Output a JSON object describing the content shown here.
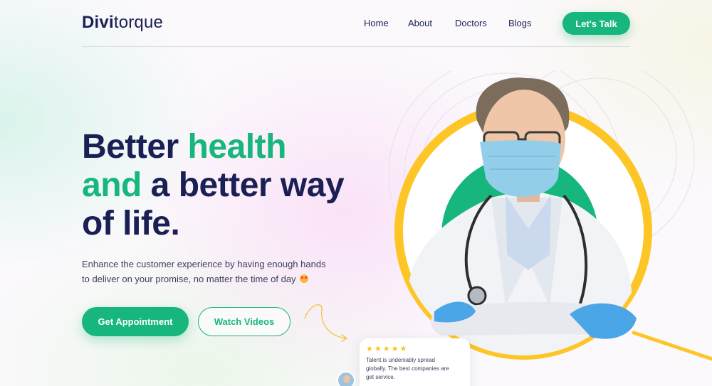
{
  "header": {
    "logo_bold": "Divi",
    "logo_rest": "torque",
    "nav": [
      "Home",
      "About",
      "Doctors",
      "Blogs"
    ],
    "cta_label": "Let's Talk"
  },
  "hero": {
    "title_1": "Better ",
    "title_2": "health",
    "title_3": "and",
    "title_4": " a better way",
    "title_5": "of life.",
    "description_1": "Enhance the customer experience by having enough hands",
    "description_2": "to deliver on your promise, no matter the time of day",
    "primary_button": "Get Appointment",
    "secondary_button": "Watch Videos"
  },
  "review": {
    "stars": "★★★★★",
    "text_1": "Talent is undeniably spread",
    "text_2": "globally. The best companies are",
    "text_3": "get service."
  },
  "colors": {
    "brand_green": "#17b67c",
    "navy": "#1a1f54",
    "accent_yellow": "#fdc626"
  },
  "icons": [
    "emoji-heart-eyes-icon",
    "star-icon",
    "curved-arrow-icon"
  ]
}
